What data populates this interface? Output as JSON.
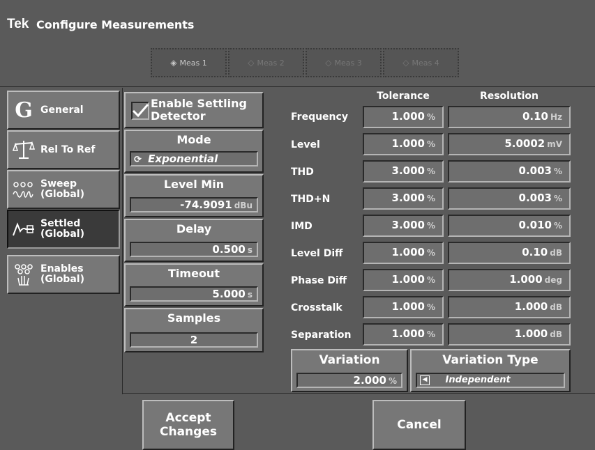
{
  "title": {
    "logo": "Tek",
    "text": "Configure Measurements"
  },
  "meas_tabs": [
    {
      "label": "Meas 1",
      "active": true
    },
    {
      "label": "Meas 2",
      "active": false
    },
    {
      "label": "Meas 3",
      "active": false
    },
    {
      "label": "Meas 4",
      "active": false
    }
  ],
  "nav": [
    {
      "label": "General",
      "icon": "general-g-icon",
      "active": false
    },
    {
      "label": "Rel To Ref",
      "icon": "scale-icon",
      "active": false
    },
    {
      "label": "Sweep\n(Global)",
      "icon": "sweep-icon",
      "active": false
    },
    {
      "label": "Settled\n(Global)",
      "icon": "settled-icon",
      "active": true
    },
    {
      "label": "Enables\n(Global)",
      "icon": "enables-hand-icon",
      "active": false
    }
  ],
  "settings": {
    "enable_settling": {
      "label": "Enable Settling\nDetector",
      "checked": true
    },
    "mode": {
      "label": "Mode",
      "value": "Exponential"
    },
    "level_min": {
      "label": "Level Min",
      "value": "-74.9091",
      "unit": "dBu"
    },
    "delay": {
      "label": "Delay",
      "value": "0.500",
      "unit": "s"
    },
    "timeout": {
      "label": "Timeout",
      "value": "5.000",
      "unit": "s"
    },
    "samples": {
      "label": "Samples",
      "value": "2"
    }
  },
  "table": {
    "tolerance_header": "Tolerance",
    "resolution_header": "Resolution",
    "rows": [
      {
        "label": "Frequency",
        "tol": "1.000",
        "tol_unit": "%",
        "res": "0.10",
        "res_unit": "Hz"
      },
      {
        "label": "Level",
        "tol": "1.000",
        "tol_unit": "%",
        "res": "5.0002",
        "res_unit": "mV"
      },
      {
        "label": "THD",
        "tol": "3.000",
        "tol_unit": "%",
        "res": "0.003",
        "res_unit": "%"
      },
      {
        "label": "THD+N",
        "tol": "3.000",
        "tol_unit": "%",
        "res": "0.003",
        "res_unit": "%"
      },
      {
        "label": "IMD",
        "tol": "3.000",
        "tol_unit": "%",
        "res": "0.010",
        "res_unit": "%"
      },
      {
        "label": "Level Diff",
        "tol": "1.000",
        "tol_unit": "%",
        "res": "0.10",
        "res_unit": "dB"
      },
      {
        "label": "Phase Diff",
        "tol": "1.000",
        "tol_unit": "%",
        "res": "1.000",
        "res_unit": "deg"
      },
      {
        "label": "Crosstalk",
        "tol": "1.000",
        "tol_unit": "%",
        "res": "1.000",
        "res_unit": "dB"
      },
      {
        "label": "Separation",
        "tol": "1.000",
        "tol_unit": "%",
        "res": "1.000",
        "res_unit": "dB"
      }
    ]
  },
  "variation": {
    "label": "Variation",
    "value": "2.000",
    "unit": "%"
  },
  "variation_type": {
    "label": "Variation Type",
    "value": "Independent"
  },
  "buttons": {
    "accept": "Accept\nChanges",
    "cancel": "Cancel"
  }
}
